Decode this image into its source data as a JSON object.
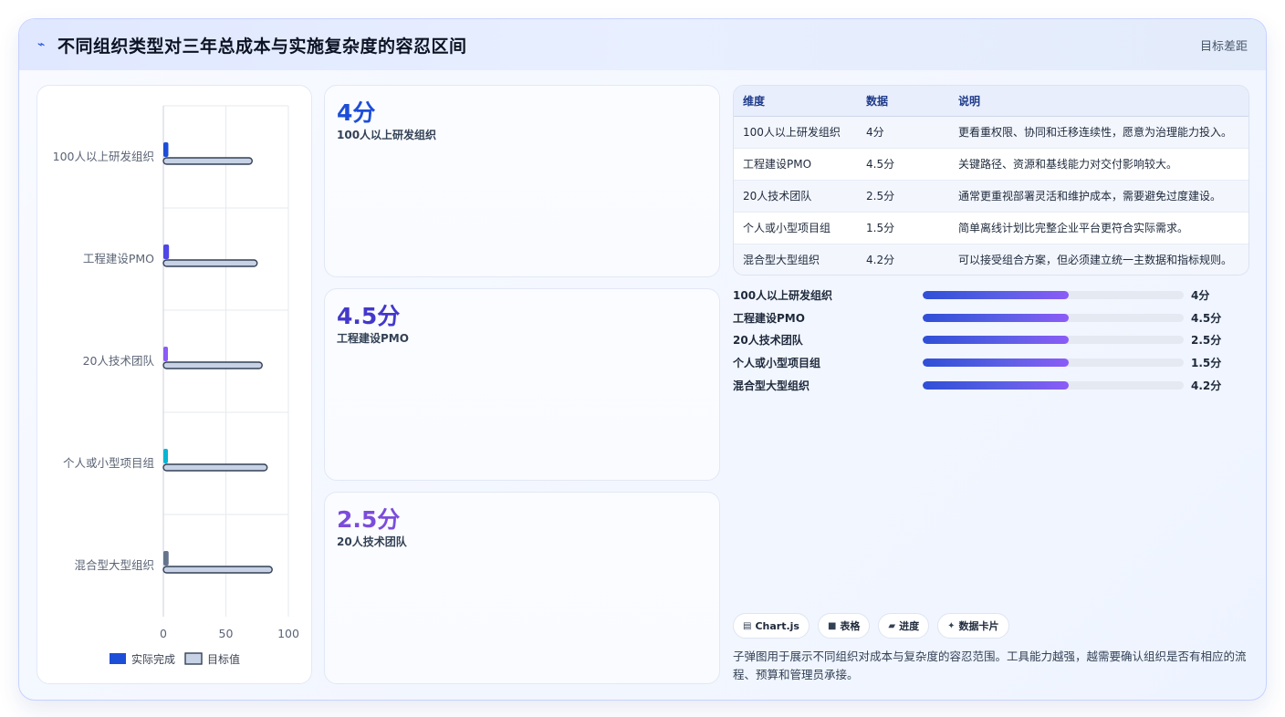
{
  "header": {
    "icon": "pulse-icon",
    "icon_glyph": "⌁",
    "title": "不同组织类型对三年总成本与实施复杂度的容忍区间",
    "tag": "目标差距"
  },
  "chart_data": {
    "type": "bar",
    "orientation": "horizontal",
    "categories": [
      "100人以上研发组织",
      "工程建设PMO",
      "20人技术团队",
      "个人或小型项目组",
      "混合型大型组织"
    ],
    "series": [
      {
        "name": "实际完成",
        "values": [
          4,
          4.5,
          2.5,
          1.5,
          4.2
        ],
        "colors": [
          "#1d4ed8",
          "#4f46e5",
          "#8b5cf6",
          "#06b6d4",
          "#64748b"
        ]
      },
      {
        "name": "目标值",
        "values": [
          71,
          75,
          79,
          83,
          87
        ],
        "color": "#c7d2e6",
        "border": "#334155"
      }
    ],
    "xlim": [
      0,
      100
    ],
    "xticks": [
      0,
      50,
      100
    ],
    "grid": true,
    "legend": "bottom"
  },
  "stats": [
    {
      "value": "4分",
      "label": "100人以上研发组织",
      "color": "#1d4ed8"
    },
    {
      "value": "4.5分",
      "label": "工程建设PMO",
      "color": "#4338ca"
    },
    {
      "value": "2.5分",
      "label": "20人技术团队",
      "color": "#7c4ddb"
    }
  ],
  "table": {
    "headers": [
      "维度",
      "数据",
      "说明"
    ],
    "rows": [
      [
        "100人以上研发组织",
        "4分",
        "更看重权限、协同和迁移连续性，愿意为治理能力投入。"
      ],
      [
        "工程建设PMO",
        "4.5分",
        "关键路径、资源和基线能力对交付影响较大。"
      ],
      [
        "20人技术团队",
        "2.5分",
        "通常更重视部署灵活和维护成本，需要避免过度建设。"
      ],
      [
        "个人或小型项目组",
        "1.5分",
        "简单离线计划比完整企业平台更符合实际需求。"
      ],
      [
        "混合型大型组织",
        "4.2分",
        "可以接受组合方案，但必须建立统一主数据和指标规则。"
      ]
    ]
  },
  "progress": [
    {
      "name": "100人以上研发组织",
      "value": "4分",
      "fill": 0.56
    },
    {
      "name": "工程建设PMO",
      "value": "4.5分",
      "fill": 0.56
    },
    {
      "name": "20人技术团队",
      "value": "2.5分",
      "fill": 0.56
    },
    {
      "name": "个人或小型项目组",
      "value": "1.5分",
      "fill": 0.56
    },
    {
      "name": "混合型大型组织",
      "value": "4.2分",
      "fill": 0.56
    }
  ],
  "chips": [
    {
      "icon": "chart-icon",
      "glyph": "▤",
      "label": "Chart.js"
    },
    {
      "icon": "table-icon",
      "glyph": "■",
      "label": "表格"
    },
    {
      "icon": "progress-icon",
      "glyph": "▰",
      "label": "进度"
    },
    {
      "icon": "sparkle-icon",
      "glyph": "✦",
      "label": "数据卡片"
    }
  ],
  "note": "子弹图用于展示不同组织对成本与复杂度的容忍范围。工具能力越强，越需要确认组织是否有相应的流程、预算和管理员承接。"
}
